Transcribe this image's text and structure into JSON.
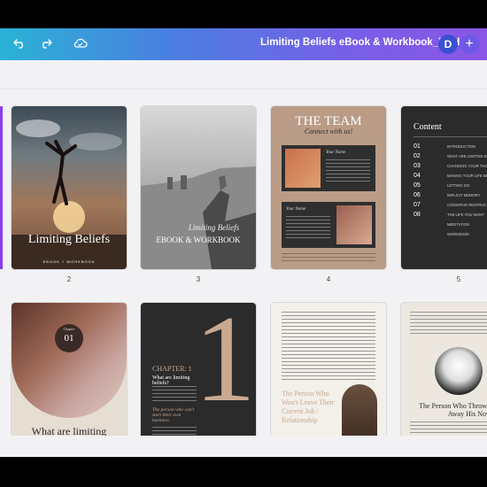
{
  "header": {
    "document_title": "Limiting Beliefs eBook & Workbook_DPH",
    "avatar_initial": "D",
    "plus_label": "+",
    "undo_icon": "undo-icon",
    "redo_icon": "redo-icon",
    "cloud_icon": "cloud-saved-icon"
  },
  "pages_row1": [
    {
      "number": "2",
      "title": "Limiting Beliefs",
      "subtitle": "EBOOK + WORKBOOK"
    },
    {
      "number": "3",
      "title": "Limiting Beliefs",
      "subtitle": "EBOOK & WORKBOOK"
    },
    {
      "number": "4",
      "title": "THE TEAM",
      "subtitle": "Connect with us!",
      "member1": "Your Name",
      "member2": "Your Name"
    },
    {
      "number": "5",
      "title": "Content",
      "toc_numbers": [
        "01",
        "02",
        "03",
        "04",
        "05",
        "06",
        "07",
        "08"
      ],
      "toc_items": [
        "INTRODUCTION",
        "WHAT ARE LIMITING BELIEFS",
        "CHANGING YOUR THOUGHTS",
        "MAKING YOUR LIFE BETTER",
        "LETTING GO",
        "IMPLICIT MEMORY",
        "COGNITIVE RESTRUCTURING",
        "THE LIFE YOU WANT",
        "MEDITATION",
        "WORKBOOK"
      ]
    }
  ],
  "pages_row2": [
    {
      "chapter_label": "Chapter",
      "chapter_number": "01",
      "title": "What are limiting"
    },
    {
      "big_number": "1",
      "chapter": "CHAPTER: 1",
      "heading": "What are limiting beliefs?",
      "pull_quote": "The person who can't start their own business."
    },
    {
      "heading": "The Person Who Won't Leave Their Current Job / Relationship"
    },
    {
      "heading": "The Person Who Throws Away His Nov"
    }
  ],
  "colors": {
    "accent": "#8b3ff0",
    "gradient_start": "#2ab3d6",
    "gradient_end": "#8b55e6",
    "tan": "#b99b86",
    "dark": "#2b2b2b"
  }
}
